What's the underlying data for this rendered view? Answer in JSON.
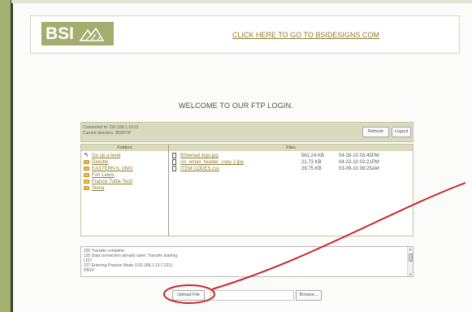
{
  "header": {
    "logo_text": "BSI",
    "link_text": "CLICK HERE TO GO TO BSIDESIGNS.COM"
  },
  "welcome": "WELCOME TO OUR FTP LOGIN.",
  "status": {
    "connected": "Connected to: 192.168.1.13:21",
    "directory": "Current directory: /BSIFTP",
    "refresh_label": "Refresh",
    "logout_label": "Logout"
  },
  "folders": {
    "header": "Folders",
    "items": [
      {
        "label": "Go up a level",
        "icon": "up-arrow-icon"
      },
      {
        "label": "Deloitte",
        "icon": "folder-icon"
      },
      {
        "label": "EASTERN IL UNIV",
        "icon": "folder-icon"
      },
      {
        "label": "Fort Lewis",
        "icon": "folder-icon"
      },
      {
        "label": "Francis Tuttle Tech",
        "icon": "folder-icon"
      },
      {
        "label": "Siena",
        "icon": "folder-icon"
      }
    ]
  },
  "files": {
    "header": "Files",
    "items": [
      {
        "name": "BSIemail logo.jpg",
        "size": "561.24 KB",
        "date": "04-28-10 03:45PM"
      },
      {
        "name": "cis_email_header_copy 2.jpg",
        "size": "21.73 KB",
        "date": "04-23-10 03:21PM"
      },
      {
        "name": "ITEM CODES.csv",
        "size": "29.75 KB",
        "date": "03-09-10 08:25AM"
      }
    ]
  },
  "log": [
    "226 Transfer complete.",
    "125 Data connection already open; Transfer starting.",
    "LIST",
    "227 Entering Passive Mode (192,168,1,13,7,221).",
    "PASV"
  ],
  "upload": {
    "upload_label": "Upload File",
    "browse_label": "Browse...",
    "file_value": ""
  },
  "colors": {
    "accent": "#a4ad6d",
    "link": "#8d7a2e",
    "annotation": "#c8262c"
  }
}
